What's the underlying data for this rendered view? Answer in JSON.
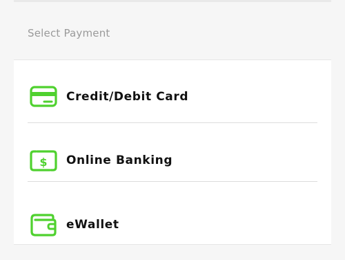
{
  "header": {
    "title": "Select Payment"
  },
  "payment_options": [
    {
      "label": "Credit/Debit Card",
      "icon": "credit-card-icon"
    },
    {
      "label": "Online Banking",
      "icon": "online-banking-icon"
    },
    {
      "label": "eWallet",
      "icon": "wallet-icon"
    }
  ],
  "colors": {
    "accent": "#4fd12f",
    "text": "#111111",
    "muted_text": "#9a9a9a",
    "background": "#f6f6f6",
    "divider": "#dcdcdc"
  }
}
